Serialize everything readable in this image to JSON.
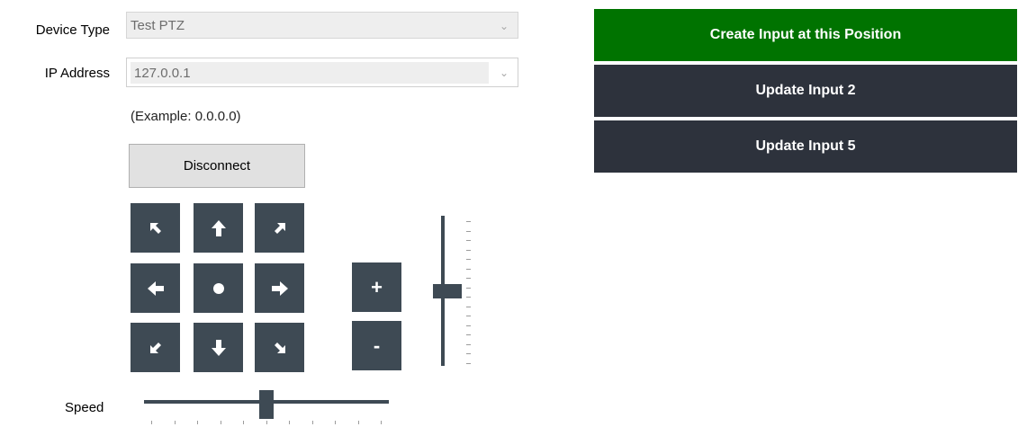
{
  "form": {
    "device_type_label": "Device Type",
    "device_type_value": "Test PTZ",
    "ip_label": "IP Address",
    "ip_value": "127.0.0.1",
    "ip_example": "(Example: 0.0.0.0)",
    "disconnect_label": "Disconnect",
    "speed_label": "Speed"
  },
  "ptz": {
    "zoom_in_label": "+",
    "zoom_out_label": "-",
    "icons": [
      "arrow-up-left-icon",
      "arrow-up-icon",
      "arrow-up-right-icon",
      "arrow-left-icon",
      "home-dot-icon",
      "arrow-right-icon",
      "arrow-down-left-icon",
      "arrow-down-icon",
      "arrow-down-right-icon"
    ]
  },
  "sliders": {
    "speed_value": 0.5,
    "zoom_value": 0.5
  },
  "actions": {
    "create_label": "Create Input at this Position",
    "update_2_label": "Update Input 2",
    "update_5_label": "Update Input 5"
  },
  "colors": {
    "create_bg": "#007300",
    "update_bg": "#2d323c",
    "ptz_bg": "#3e4a54"
  }
}
